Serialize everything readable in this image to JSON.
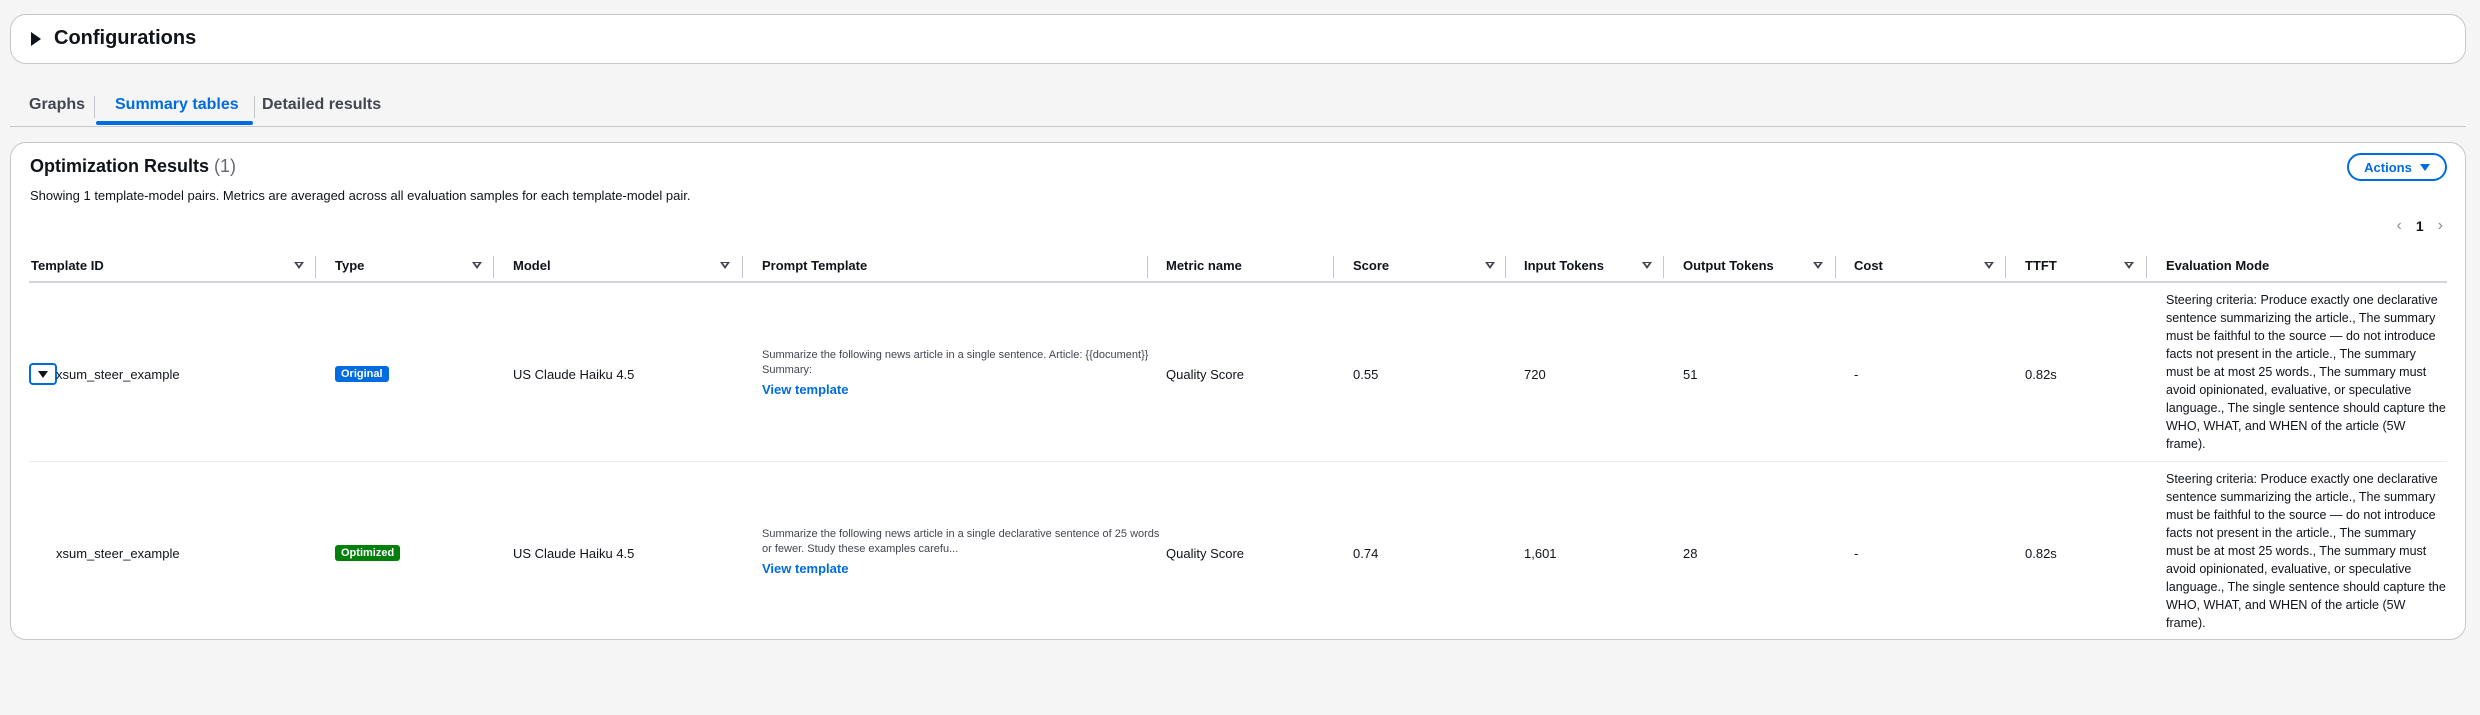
{
  "configurations": {
    "title": "Configurations"
  },
  "tabs": [
    {
      "label": "Graphs"
    },
    {
      "label": "Summary tables"
    },
    {
      "label": "Detailed results"
    }
  ],
  "results": {
    "title": "Optimization Results",
    "count": "(1)",
    "description": "Showing 1 template-model pairs. Metrics are averaged across all evaluation samples for each template-model pair.",
    "actions_label": "Actions",
    "page_number": "1"
  },
  "columns": [
    {
      "label": "Template ID"
    },
    {
      "label": "Type"
    },
    {
      "label": "Model"
    },
    {
      "label": "Prompt Template"
    },
    {
      "label": "Metric name"
    },
    {
      "label": "Score"
    },
    {
      "label": "Input Tokens"
    },
    {
      "label": "Output Tokens"
    },
    {
      "label": "Cost"
    },
    {
      "label": "TTFT"
    },
    {
      "label": "Evaluation Mode"
    }
  ],
  "rows": [
    {
      "template_id": "xsum_steer_example",
      "type": "Original",
      "model": "US Claude Haiku 4.5",
      "prompt": "Summarize the following news article in a single sentence. Article: {{document}} Summary:",
      "view_template": "View template",
      "metric": "Quality Score",
      "score": "0.55",
      "input_tokens": "720",
      "output_tokens": "51",
      "cost": "-",
      "ttft": "0.82s",
      "eval_mode": "Steering criteria: Produce exactly one declarative sentence summarizing the article., The summary must be faithful to the source — do not introduce facts not present in the article., The summary must be at most 25 words., The summary must avoid opinionated, evaluative, or speculative language., The single sentence should capture the WHO, WHAT, and WHEN of the article (5W frame)."
    },
    {
      "template_id": "xsum_steer_example",
      "type": "Optimized",
      "model": "US Claude Haiku 4.5",
      "prompt": "Summarize the following news article in a single declarative sentence of 25 words or fewer. Study these examples carefu...",
      "view_template": "View template",
      "metric": "Quality Score",
      "score": "0.74",
      "input_tokens": "1,601",
      "output_tokens": "28",
      "cost": "-",
      "ttft": "0.82s",
      "eval_mode": "Steering criteria: Produce exactly one declarative sentence summarizing the article., The summary must be faithful to the source — do not introduce facts not present in the article., The summary must be at most 25 words., The summary must avoid opinionated, evaluative, or speculative language., The single sentence should capture the WHO, WHAT, and WHEN of the article (5W frame)."
    }
  ],
  "colors": {
    "accent": "#006ce0",
    "original_badge": "#006ce0",
    "optimized_badge": "#037f0c"
  }
}
